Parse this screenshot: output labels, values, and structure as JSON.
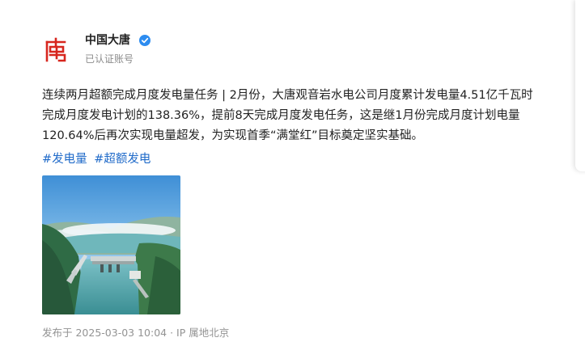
{
  "author": {
    "name": "中国大唐",
    "account_type": "已认证账号",
    "verified_icon": "verified-badge-icon",
    "avatar_icon": "datang-logo-icon",
    "brand_color": "#d7261e",
    "verified_color": "#2d8cf0"
  },
  "post": {
    "lines": [
      "连续两月超额完成月度发电量任务 | 2月份，大唐观音岩水电公司月度累计发电量4.51亿千瓦时",
      "完成月度发电计划的138.36%，提前8天完成月度发电任务，这是继1月份完成月度计划电量",
      "120.64%后再次实现电量超发，为实现首季“满堂红”目标奠定坚实基础。"
    ],
    "hashtags": [
      "#发电量",
      "#超额发电"
    ],
    "hashtag_color": "#1f6ac9",
    "image_icon": "hydropower-dam-photo"
  },
  "meta": {
    "text": "发布于 2025-03-03 10:04 · IP 属地北京"
  }
}
